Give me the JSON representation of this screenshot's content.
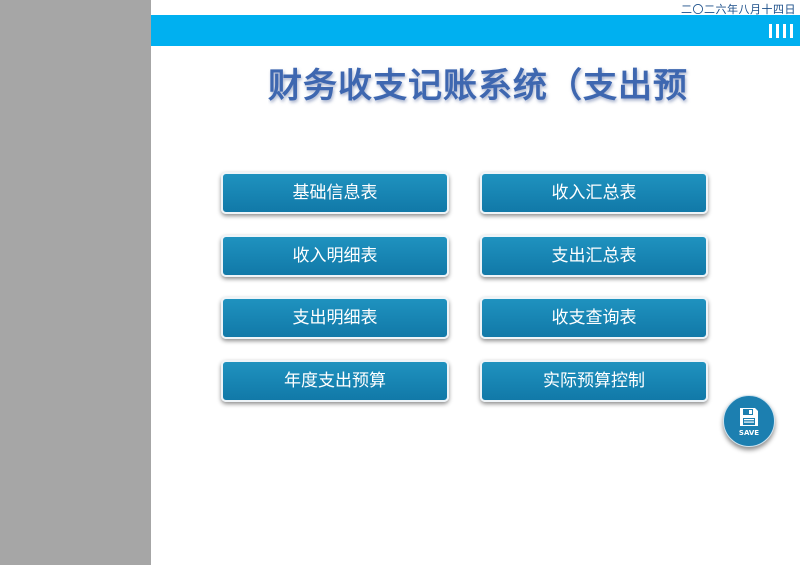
{
  "header": {
    "date": "二〇二六年八月十四日",
    "title": "财务收支记账系统（支出预"
  },
  "menu": {
    "buttons": [
      {
        "label": "基础信息表"
      },
      {
        "label": "收入汇总表"
      },
      {
        "label": "收入明细表"
      },
      {
        "label": "支出汇总表"
      },
      {
        "label": "支出明细表"
      },
      {
        "label": "收支查询表"
      },
      {
        "label": "年度支出预算"
      },
      {
        "label": "实际预算控制"
      }
    ]
  },
  "save": {
    "label": "SAVE",
    "icon": "floppy-disk-icon"
  },
  "colors": {
    "header_bar": "#00b0f0",
    "left_panel": "#a6a6a6",
    "button": "#1482b0",
    "title": "#3e67b0"
  }
}
